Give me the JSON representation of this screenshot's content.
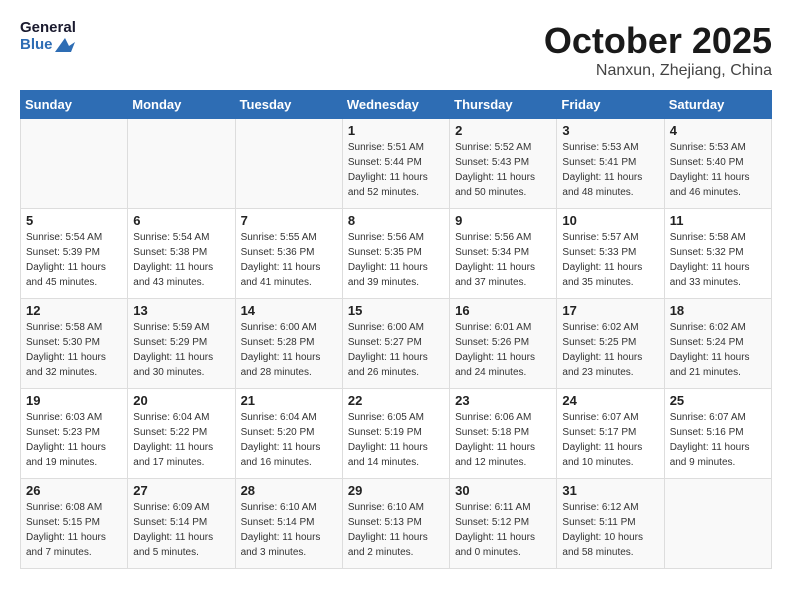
{
  "header": {
    "logo_line1": "General",
    "logo_line2": "Blue",
    "month": "October 2025",
    "location": "Nanxun, Zhejiang, China"
  },
  "weekdays": [
    "Sunday",
    "Monday",
    "Tuesday",
    "Wednesday",
    "Thursday",
    "Friday",
    "Saturday"
  ],
  "weeks": [
    [
      {
        "day": "",
        "sunrise": "",
        "sunset": "",
        "daylight": ""
      },
      {
        "day": "",
        "sunrise": "",
        "sunset": "",
        "daylight": ""
      },
      {
        "day": "",
        "sunrise": "",
        "sunset": "",
        "daylight": ""
      },
      {
        "day": "1",
        "sunrise": "Sunrise: 5:51 AM",
        "sunset": "Sunset: 5:44 PM",
        "daylight": "Daylight: 11 hours and 52 minutes."
      },
      {
        "day": "2",
        "sunrise": "Sunrise: 5:52 AM",
        "sunset": "Sunset: 5:43 PM",
        "daylight": "Daylight: 11 hours and 50 minutes."
      },
      {
        "day": "3",
        "sunrise": "Sunrise: 5:53 AM",
        "sunset": "Sunset: 5:41 PM",
        "daylight": "Daylight: 11 hours and 48 minutes."
      },
      {
        "day": "4",
        "sunrise": "Sunrise: 5:53 AM",
        "sunset": "Sunset: 5:40 PM",
        "daylight": "Daylight: 11 hours and 46 minutes."
      }
    ],
    [
      {
        "day": "5",
        "sunrise": "Sunrise: 5:54 AM",
        "sunset": "Sunset: 5:39 PM",
        "daylight": "Daylight: 11 hours and 45 minutes."
      },
      {
        "day": "6",
        "sunrise": "Sunrise: 5:54 AM",
        "sunset": "Sunset: 5:38 PM",
        "daylight": "Daylight: 11 hours and 43 minutes."
      },
      {
        "day": "7",
        "sunrise": "Sunrise: 5:55 AM",
        "sunset": "Sunset: 5:36 PM",
        "daylight": "Daylight: 11 hours and 41 minutes."
      },
      {
        "day": "8",
        "sunrise": "Sunrise: 5:56 AM",
        "sunset": "Sunset: 5:35 PM",
        "daylight": "Daylight: 11 hours and 39 minutes."
      },
      {
        "day": "9",
        "sunrise": "Sunrise: 5:56 AM",
        "sunset": "Sunset: 5:34 PM",
        "daylight": "Daylight: 11 hours and 37 minutes."
      },
      {
        "day": "10",
        "sunrise": "Sunrise: 5:57 AM",
        "sunset": "Sunset: 5:33 PM",
        "daylight": "Daylight: 11 hours and 35 minutes."
      },
      {
        "day": "11",
        "sunrise": "Sunrise: 5:58 AM",
        "sunset": "Sunset: 5:32 PM",
        "daylight": "Daylight: 11 hours and 33 minutes."
      }
    ],
    [
      {
        "day": "12",
        "sunrise": "Sunrise: 5:58 AM",
        "sunset": "Sunset: 5:30 PM",
        "daylight": "Daylight: 11 hours and 32 minutes."
      },
      {
        "day": "13",
        "sunrise": "Sunrise: 5:59 AM",
        "sunset": "Sunset: 5:29 PM",
        "daylight": "Daylight: 11 hours and 30 minutes."
      },
      {
        "day": "14",
        "sunrise": "Sunrise: 6:00 AM",
        "sunset": "Sunset: 5:28 PM",
        "daylight": "Daylight: 11 hours and 28 minutes."
      },
      {
        "day": "15",
        "sunrise": "Sunrise: 6:00 AM",
        "sunset": "Sunset: 5:27 PM",
        "daylight": "Daylight: 11 hours and 26 minutes."
      },
      {
        "day": "16",
        "sunrise": "Sunrise: 6:01 AM",
        "sunset": "Sunset: 5:26 PM",
        "daylight": "Daylight: 11 hours and 24 minutes."
      },
      {
        "day": "17",
        "sunrise": "Sunrise: 6:02 AM",
        "sunset": "Sunset: 5:25 PM",
        "daylight": "Daylight: 11 hours and 23 minutes."
      },
      {
        "day": "18",
        "sunrise": "Sunrise: 6:02 AM",
        "sunset": "Sunset: 5:24 PM",
        "daylight": "Daylight: 11 hours and 21 minutes."
      }
    ],
    [
      {
        "day": "19",
        "sunrise": "Sunrise: 6:03 AM",
        "sunset": "Sunset: 5:23 PM",
        "daylight": "Daylight: 11 hours and 19 minutes."
      },
      {
        "day": "20",
        "sunrise": "Sunrise: 6:04 AM",
        "sunset": "Sunset: 5:22 PM",
        "daylight": "Daylight: 11 hours and 17 minutes."
      },
      {
        "day": "21",
        "sunrise": "Sunrise: 6:04 AM",
        "sunset": "Sunset: 5:20 PM",
        "daylight": "Daylight: 11 hours and 16 minutes."
      },
      {
        "day": "22",
        "sunrise": "Sunrise: 6:05 AM",
        "sunset": "Sunset: 5:19 PM",
        "daylight": "Daylight: 11 hours and 14 minutes."
      },
      {
        "day": "23",
        "sunrise": "Sunrise: 6:06 AM",
        "sunset": "Sunset: 5:18 PM",
        "daylight": "Daylight: 11 hours and 12 minutes."
      },
      {
        "day": "24",
        "sunrise": "Sunrise: 6:07 AM",
        "sunset": "Sunset: 5:17 PM",
        "daylight": "Daylight: 11 hours and 10 minutes."
      },
      {
        "day": "25",
        "sunrise": "Sunrise: 6:07 AM",
        "sunset": "Sunset: 5:16 PM",
        "daylight": "Daylight: 11 hours and 9 minutes."
      }
    ],
    [
      {
        "day": "26",
        "sunrise": "Sunrise: 6:08 AM",
        "sunset": "Sunset: 5:15 PM",
        "daylight": "Daylight: 11 hours and 7 minutes."
      },
      {
        "day": "27",
        "sunrise": "Sunrise: 6:09 AM",
        "sunset": "Sunset: 5:14 PM",
        "daylight": "Daylight: 11 hours and 5 minutes."
      },
      {
        "day": "28",
        "sunrise": "Sunrise: 6:10 AM",
        "sunset": "Sunset: 5:14 PM",
        "daylight": "Daylight: 11 hours and 3 minutes."
      },
      {
        "day": "29",
        "sunrise": "Sunrise: 6:10 AM",
        "sunset": "Sunset: 5:13 PM",
        "daylight": "Daylight: 11 hours and 2 minutes."
      },
      {
        "day": "30",
        "sunrise": "Sunrise: 6:11 AM",
        "sunset": "Sunset: 5:12 PM",
        "daylight": "Daylight: 11 hours and 0 minutes."
      },
      {
        "day": "31",
        "sunrise": "Sunrise: 6:12 AM",
        "sunset": "Sunset: 5:11 PM",
        "daylight": "Daylight: 10 hours and 58 minutes."
      },
      {
        "day": "",
        "sunrise": "",
        "sunset": "",
        "daylight": ""
      }
    ]
  ]
}
